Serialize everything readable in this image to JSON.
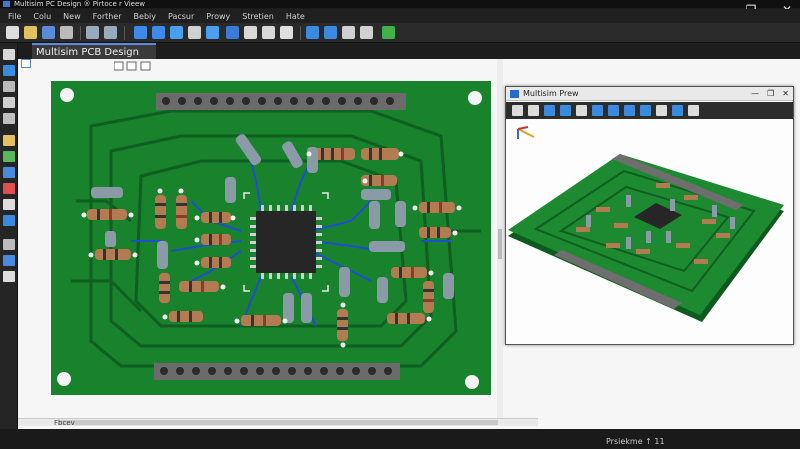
{
  "window": {
    "title": "Multisim PC Design ® Pirtoce r Vieew",
    "controls": [
      "—",
      "❐",
      "✕"
    ]
  },
  "menu": [
    "File",
    "Colu",
    "New",
    "Forther",
    "Bebiy",
    "Pacsur",
    "Prowy",
    "Stretien",
    "Hate"
  ],
  "tab": {
    "label": "Multisim PCB Design"
  },
  "preview": {
    "title": "Multisim Prew",
    "controls": [
      "—",
      "❐",
      "✕"
    ]
  },
  "scroll": {
    "label": "Fbcev"
  },
  "status": {
    "right_text": "Prsiekme ↑ 11",
    "left_text": ""
  },
  "colors": {
    "board": "#19822d",
    "trace": "#0f5f20",
    "via_trace": "#1d4fd0",
    "header": "#6b6b6b",
    "chip": "#262626",
    "resistor": "#b37b52",
    "capacitor": "#8a9aa6",
    "accent": "#4a8ae0"
  },
  "icons": {
    "toolbar": [
      "new-icon",
      "open-icon",
      "save-icon",
      "print-icon",
      "undo-icon",
      "redo-icon",
      "zoom-in-icon",
      "zoom-out-icon",
      "select-icon",
      "wire-icon",
      "component-icon",
      "trace-icon",
      "via-icon",
      "measure-icon",
      "copy-icon",
      "rotate-icon",
      "flip-icon",
      "layer-icon",
      "find-icon",
      "grid-icon",
      "snap-icon",
      "check-icon",
      "settings-icon",
      "power-icon"
    ],
    "toolbox": [
      "pointer-icon",
      "draw-icon",
      "arc-icon",
      "line-icon",
      "pad-icon",
      "text-icon",
      "measure-icon",
      "layer-icon",
      "eraser-icon",
      "fill-icon",
      "via-icon",
      "grid-icon",
      "zoom-icon",
      "probe-icon",
      "settings-icon"
    ],
    "preview_toolbar": [
      "pan-icon",
      "rotate-icon",
      "zoom-icon",
      "layer-icon",
      "tilt-icon",
      "light-icon",
      "copper-icon",
      "silk-icon",
      "view-icon",
      "fit-icon",
      "camera-icon",
      "search-icon",
      "reset-icon"
    ]
  }
}
